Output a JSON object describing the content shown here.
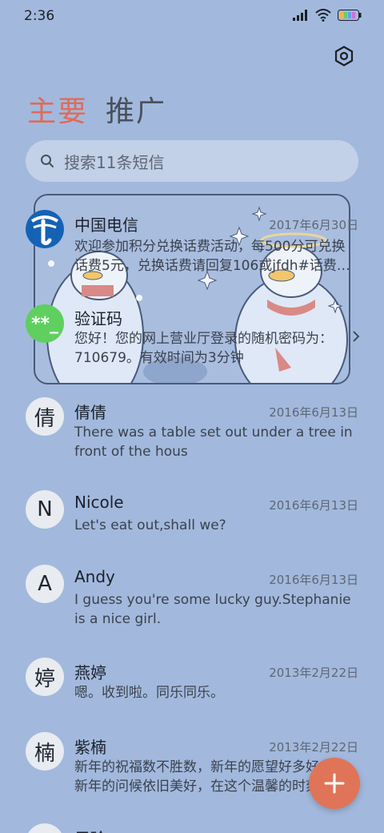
{
  "status": {
    "time": "2:36",
    "icons": [
      "signal-icon",
      "wifi-icon",
      "battery-icon"
    ]
  },
  "header": {
    "settings_icon": "gear-icon"
  },
  "tabs": [
    {
      "label": "主要"
    },
    {
      "label": "推广"
    }
  ],
  "search": {
    "placeholder": "搜索11条短信"
  },
  "conversations": [
    {
      "name": "中国电信",
      "date": "2017年6月30日",
      "preview": "欢迎参加积分兑换话费活动，每500分可兑换话费5元，兑换话费请回复106或jfdh#话费…",
      "avatar": ""
    },
    {
      "name": "验证码",
      "date": "",
      "preview": "您好！您的网上营业厅登录的随机密码为：710679。有效时间为3分钟",
      "avatar": "**_"
    },
    {
      "name": "倩倩",
      "date": "2016年6月13日",
      "preview": "There was a table set out under a tree in front of the hous",
      "avatar": "倩"
    },
    {
      "name": "Nicole",
      "date": "2016年6月13日",
      "preview": "Let's eat out,shall we?",
      "avatar": "N"
    },
    {
      "name": "Andy",
      "date": "2016年6月13日",
      "preview": "I guess you're some lucky guy.Stephanie is a nice girl.",
      "avatar": "A"
    },
    {
      "name": "燕婷",
      "date": "2013年2月22日",
      "preview": "嗯。收到啦。同乐同乐。",
      "avatar": "婷"
    },
    {
      "name": "紫楠",
      "date": "2013年2月22日",
      "preview": "新年的祝福数不胜数，新年的愿望好多好多，新年的问候依旧美好，在这个温馨的时刻",
      "avatar": "楠"
    },
    {
      "name": "子玲",
      "date": "",
      "preview": "",
      "avatar": ""
    }
  ],
  "colors": {
    "accent": "#e06b57",
    "background": "#a2b9dd",
    "fab": "#e07459"
  }
}
